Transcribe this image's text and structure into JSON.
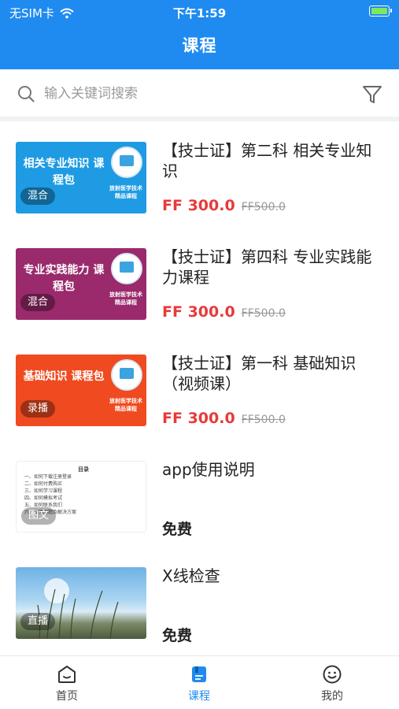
{
  "status_bar": {
    "carrier": "无SIM卡",
    "time": "下午1:59"
  },
  "header": {
    "title": "课程"
  },
  "search": {
    "placeholder": "输入关键词搜索"
  },
  "courses": [
    {
      "thumb_title": "相关专业知识 课程包",
      "thumb_subtitle": "放射医学技术 精品课程",
      "tag": "混合",
      "thumb_color": "#1e9be3",
      "title": "【技士证】第二科 相关专业知识",
      "price": "FF 300.0",
      "original_price": "FF500.0"
    },
    {
      "thumb_title": "专业实践能力 课程包",
      "thumb_subtitle": "放射医学技术 精品课程",
      "tag": "混合",
      "thumb_color": "#9a2a6c",
      "title": "【技士证】第四科 专业实践能力课程",
      "price": "FF 300.0",
      "original_price": "FF500.0"
    },
    {
      "thumb_title": "基础知识 课程包",
      "thumb_subtitle": "放射医学技术 精品课程",
      "tag": "录播",
      "thumb_color": "#f04a20",
      "title": "【技士证】第一科 基础知识（视频课）",
      "price": "FF 300.0",
      "original_price": "FF500.0"
    },
    {
      "thumb_lines": [
        "目录",
        "一、如何下载注册登录",
        "二、如何付费购买",
        "三、如何学习课程",
        "四、如何模拟考试",
        "五、如何联系我们",
        "六、常见问题及解决方案"
      ],
      "tag": "图文",
      "title": "app使用说明",
      "price_label": "免费"
    },
    {
      "tag": "直播",
      "title": "X线检查",
      "price_label": "免费"
    }
  ],
  "bottom_nav": [
    {
      "label": "首页",
      "icon": "home-icon",
      "active": false
    },
    {
      "label": "课程",
      "icon": "course-icon",
      "active": true
    },
    {
      "label": "我的",
      "icon": "profile-icon",
      "active": false
    }
  ],
  "colors": {
    "primary": "#1f8bf0",
    "price": "#e73a3a"
  }
}
